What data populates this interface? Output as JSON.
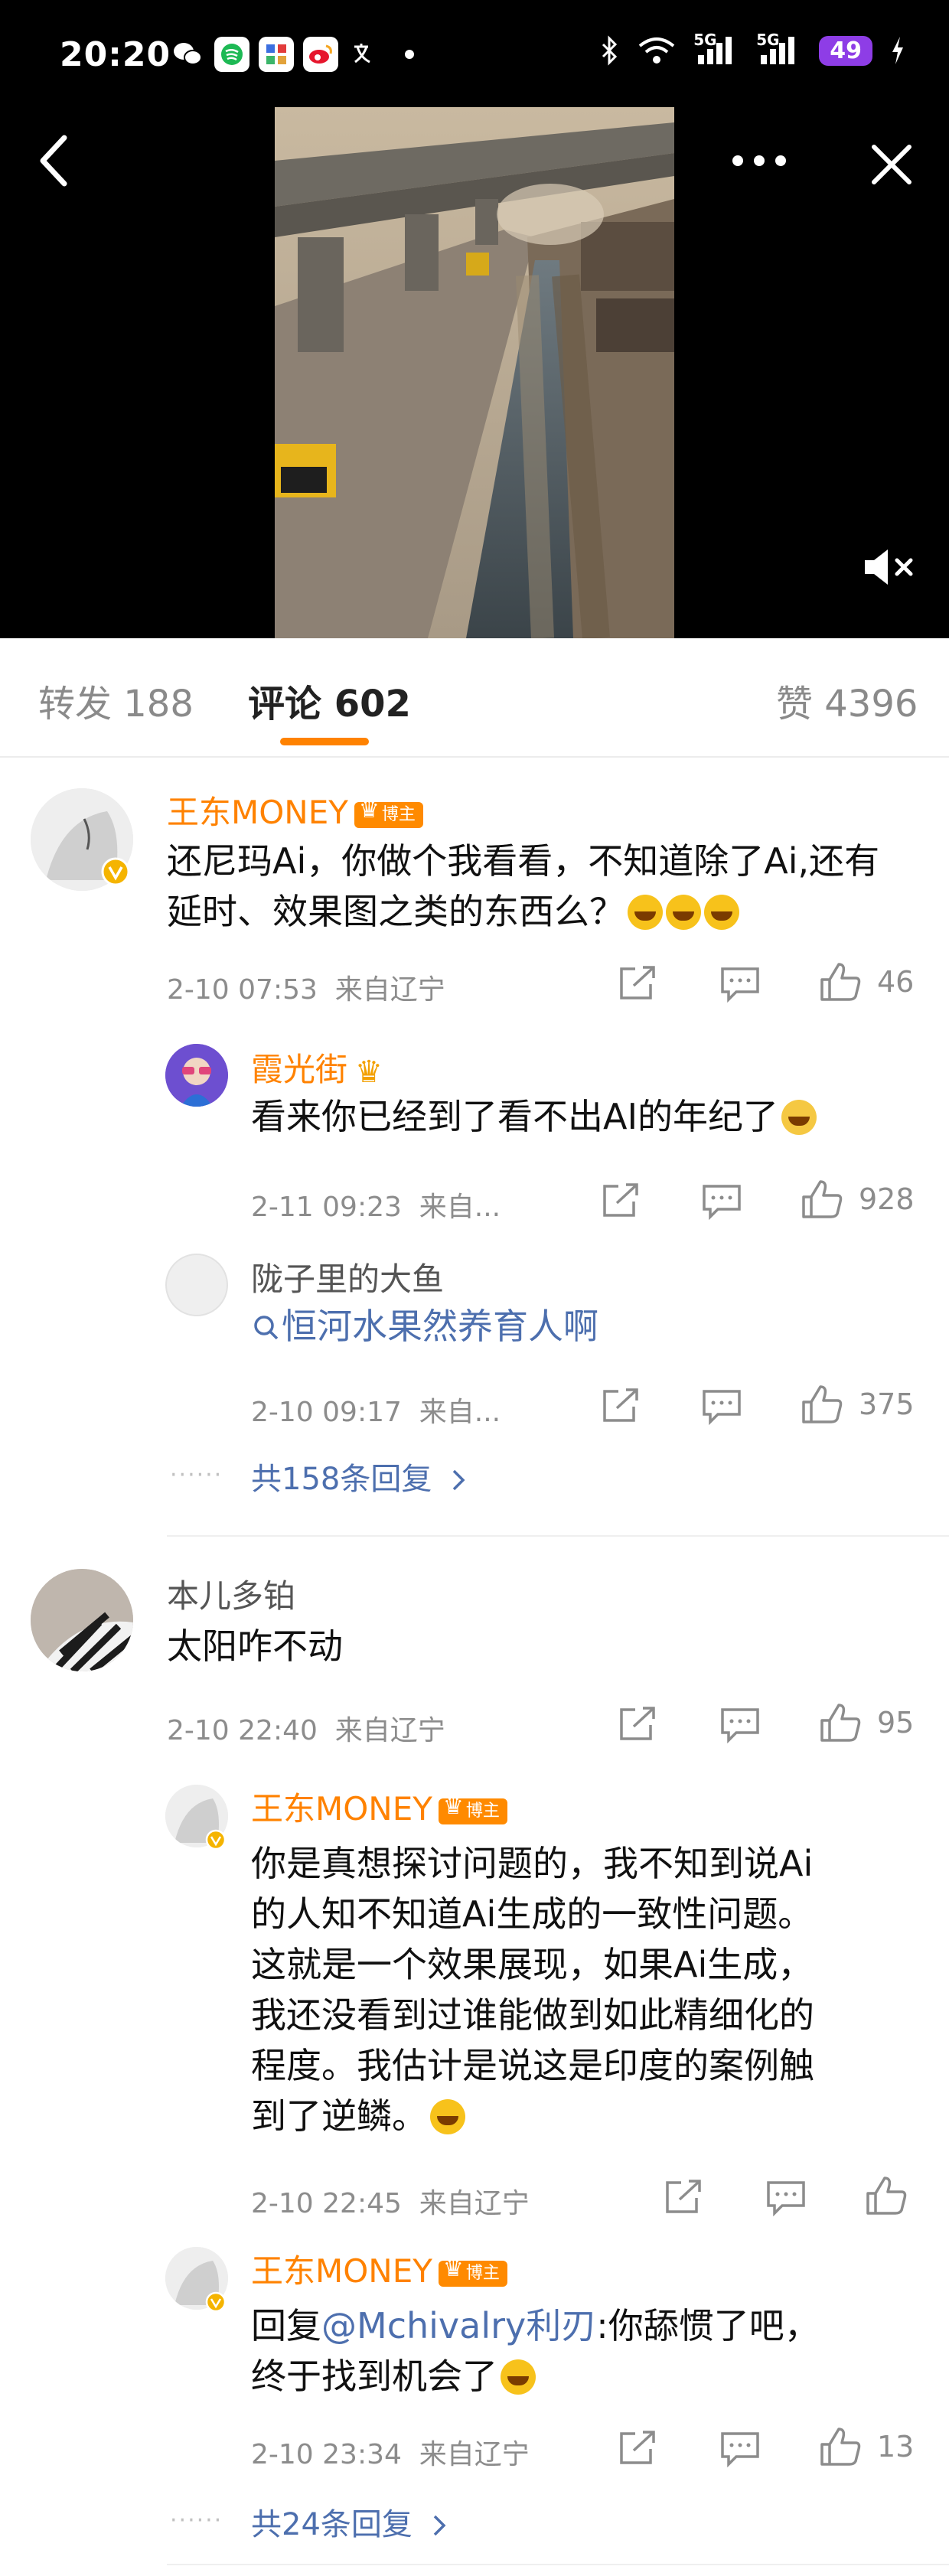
{
  "status": {
    "time": "20:20",
    "battery": "49",
    "signal1": "5G",
    "signal2": "5G"
  },
  "tabs": {
    "repost": "转发 188",
    "comments": "评论 602",
    "likes": "赞 4396"
  },
  "comments": [
    {
      "name": "王东MONEY",
      "badge": "博主",
      "text": "还尼玛Ai，你做个我看看，不知道除了Ai,还有延时、效果图之类的东西么？",
      "time": "2-10 07:53",
      "location": "来自辽宁",
      "likes": "46",
      "replies": [
        {
          "name": "霞光街",
          "text": "看来你已经到了看不出AI的年纪了",
          "time": "2-11 09:23",
          "location": "来自...",
          "likes": "928"
        },
        {
          "name": "陇子里的大鱼",
          "text": "恒河水果然养育人啊",
          "time": "2-10 09:17",
          "location": "来自...",
          "likes": "375"
        }
      ],
      "more_replies": "共158条回复"
    },
    {
      "name": "本儿多铂",
      "text": "太阳咋不动",
      "time": "2-10 22:40",
      "location": "来自辽宁",
      "likes": "95",
      "replies": [
        {
          "name": "王东MONEY",
          "badge": "博主",
          "text_lines": [
            "你是真想探讨问题的，我不知到说Ai",
            "的人知不知道Ai生成的一致性问题。",
            "这就是一个效果展现，如果Ai生成，",
            "我还没看到过谁能做到如此精细化的",
            "程度。我估计是说这是印度的案例触",
            "到了逆鳞。"
          ],
          "time": "2-10 22:45",
          "location": "来自辽宁",
          "likes": ""
        },
        {
          "name": "王东MONEY",
          "badge": "博主",
          "reply_prefix": "回复",
          "mention": "@Mchivalry利刃",
          "text_line1": ":你舔惯了吧，",
          "text_line2": "终于找到机会了",
          "time": "2-10 23:34",
          "location": "来自辽宁",
          "likes": "13"
        }
      ],
      "more_replies": "共24条回复"
    }
  ]
}
